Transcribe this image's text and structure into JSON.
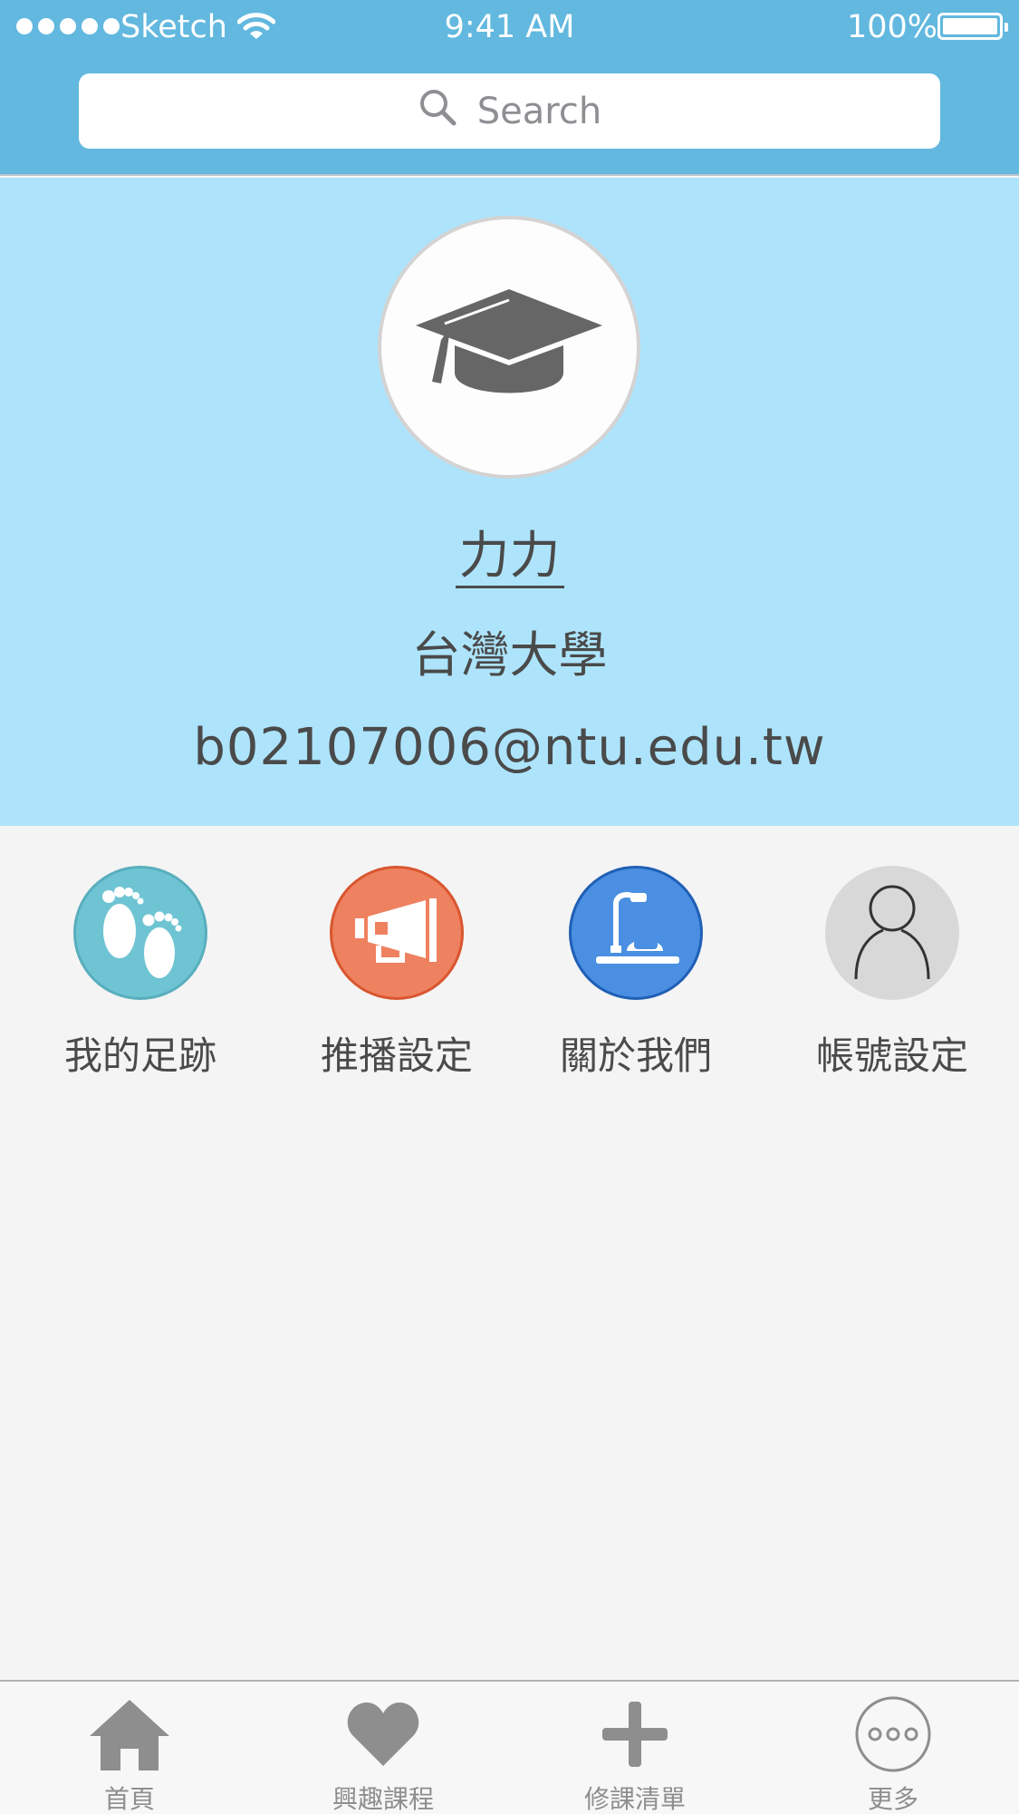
{
  "status_bar": {
    "carrier": "Sketch",
    "time": "9:41 AM",
    "battery": "100%"
  },
  "search": {
    "placeholder": "Search"
  },
  "profile": {
    "avatar_icon": "graduation-cap-icon",
    "name": "力力",
    "school": "台灣大學",
    "email": "b02107006@ntu.edu.tw"
  },
  "actions": [
    {
      "label": "我的足跡",
      "icon": "footprints-icon",
      "color": "#6fc4d3"
    },
    {
      "label": "推播設定",
      "icon": "megaphone-icon",
      "color": "#ee8160"
    },
    {
      "label": "關於我們",
      "icon": "desk-lamp-icon",
      "color": "#4a8fe2"
    },
    {
      "label": "帳號設定",
      "icon": "person-icon",
      "color": "#d8d8d8"
    }
  ],
  "tabs": [
    {
      "label": "首頁",
      "icon": "home-icon"
    },
    {
      "label": "興趣課程",
      "icon": "heart-icon"
    },
    {
      "label": "修課清單",
      "icon": "plus-icon"
    },
    {
      "label": "更多",
      "icon": "more-icon"
    }
  ],
  "colors": {
    "topbar": "#62b8df",
    "profile_bg": "#ade4fc",
    "page_bg": "#f4f4f4"
  }
}
